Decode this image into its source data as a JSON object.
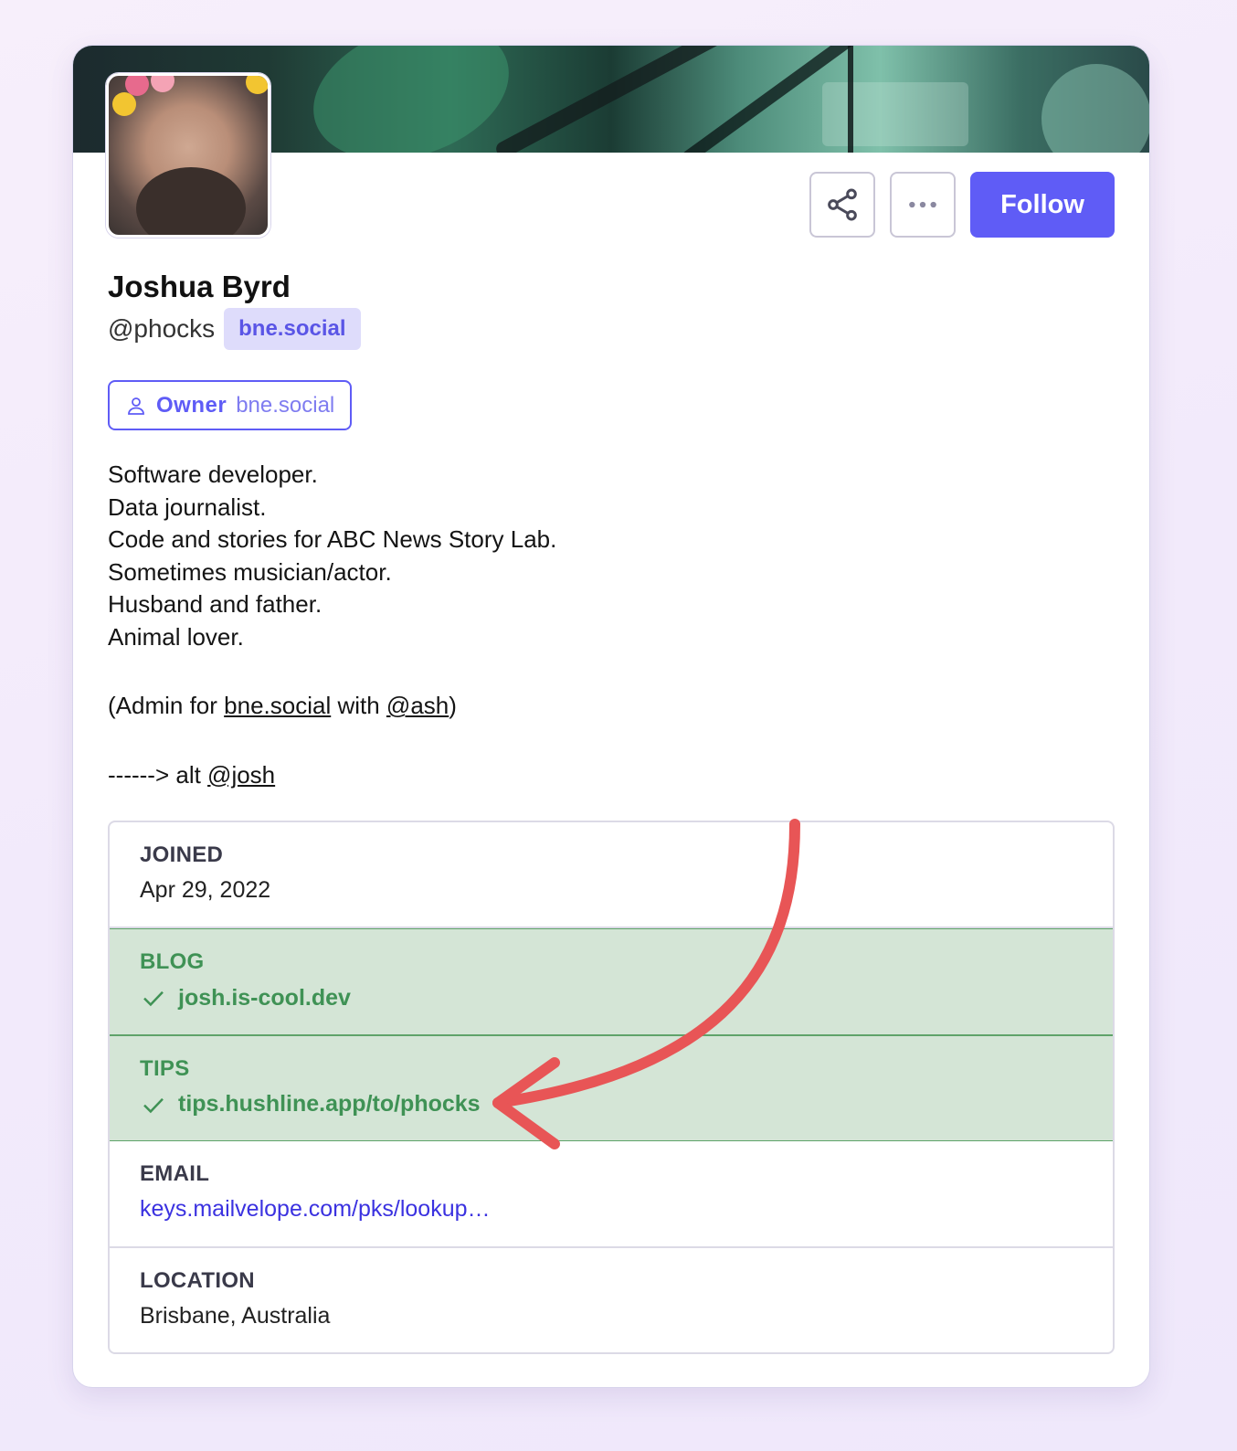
{
  "profile": {
    "display_name": "Joshua Byrd",
    "handle": "@phocks",
    "server": "bne.social"
  },
  "actions": {
    "share_icon": "share-icon",
    "more_icon": "more-horizontal-icon",
    "follow_label": "Follow"
  },
  "role": {
    "icon": "user-icon",
    "name": "Owner",
    "server": "bne.social"
  },
  "bio": {
    "lines": [
      "Software developer.",
      "Data journalist.",
      "Code and stories for ABC News Story Lab.",
      "Sometimes musician/actor.",
      "Husband and father.",
      "Animal lover."
    ],
    "admin_prefix": "(Admin for ",
    "admin_link": "bne.social",
    "admin_mid": " with ",
    "admin_mention": "@ash",
    "admin_suffix": ")",
    "alt_prefix": "------> alt ",
    "alt_mention": "@josh"
  },
  "fields": [
    {
      "label": "JOINED",
      "value": "Apr 29, 2022",
      "verified": false
    },
    {
      "label": "BLOG",
      "value": "josh.is-cool.dev",
      "verified": true
    },
    {
      "label": "TIPS",
      "value": "tips.hushline.app/to/phocks",
      "verified": true
    },
    {
      "label": "EMAIL",
      "value": "keys.mailvelope.com/pks/lookup…",
      "verified": false
    },
    {
      "label": "LOCATION",
      "value": "Brisbane, Australia",
      "verified": false
    }
  ],
  "colors": {
    "accent": "#5f5cf6",
    "verified_bg": "#d4e5d6",
    "verified_text": "#3f9255",
    "annotation_arrow": "#e85556"
  }
}
